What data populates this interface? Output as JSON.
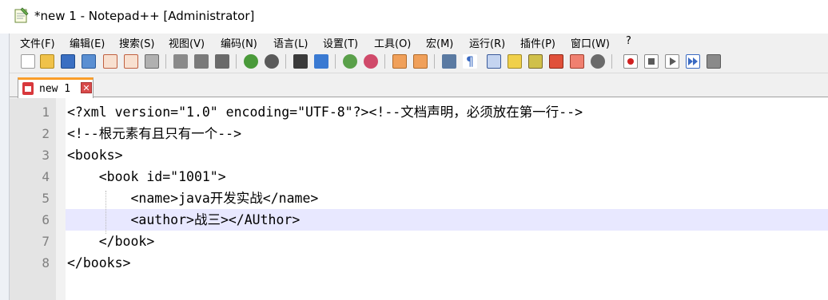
{
  "window": {
    "title": "*new 1 - Notepad++ [Administrator]"
  },
  "menu": [
    "文件(F)",
    "编辑(E)",
    "搜索(S)",
    "视图(V)",
    "编码(N)",
    "语言(L)",
    "设置(T)",
    "工具(O)",
    "宏(M)",
    "运行(R)",
    "插件(P)",
    "窗口(W)",
    "?"
  ],
  "toolbar": {
    "icons": [
      "new-file-icon",
      "open-file-icon",
      "save-icon",
      "save-all-icon",
      "close-icon",
      "close-all-icon",
      "print-icon",
      "cut-icon",
      "copy-icon",
      "paste-icon",
      "undo-icon",
      "redo-icon",
      "find-icon",
      "replace-icon",
      "zoom-in-icon",
      "zoom-out-icon",
      "sync-vertical-icon",
      "sync-horizontal-icon",
      "word-wrap-icon",
      "show-all-chars-icon",
      "indent-guide-icon",
      "user-lang-icon",
      "doc-map-icon",
      "function-list-icon",
      "folder-workspace-icon",
      "monitor-icon",
      "record-macro-icon",
      "stop-macro-icon",
      "play-macro-icon",
      "run-macro-multiple-icon",
      "save-macro-icon"
    ]
  },
  "tab": {
    "label": "new 1",
    "close_glyph": "✕"
  },
  "editor": {
    "current_line": 6,
    "lines": [
      "<?xml version=\"1.0\" encoding=\"UTF-8\"?><!--文档声明，必须放在第一行-->",
      "<!--根元素有且只有一个-->",
      "<books>",
      "    <book id=\"1001\">",
      "        <name>java开发实战</name>",
      "        <author>战三></AUthor>",
      "    </book>",
      "</books>"
    ],
    "line_numbers": [
      "1",
      "2",
      "3",
      "4",
      "5",
      "6",
      "7",
      "8"
    ]
  }
}
